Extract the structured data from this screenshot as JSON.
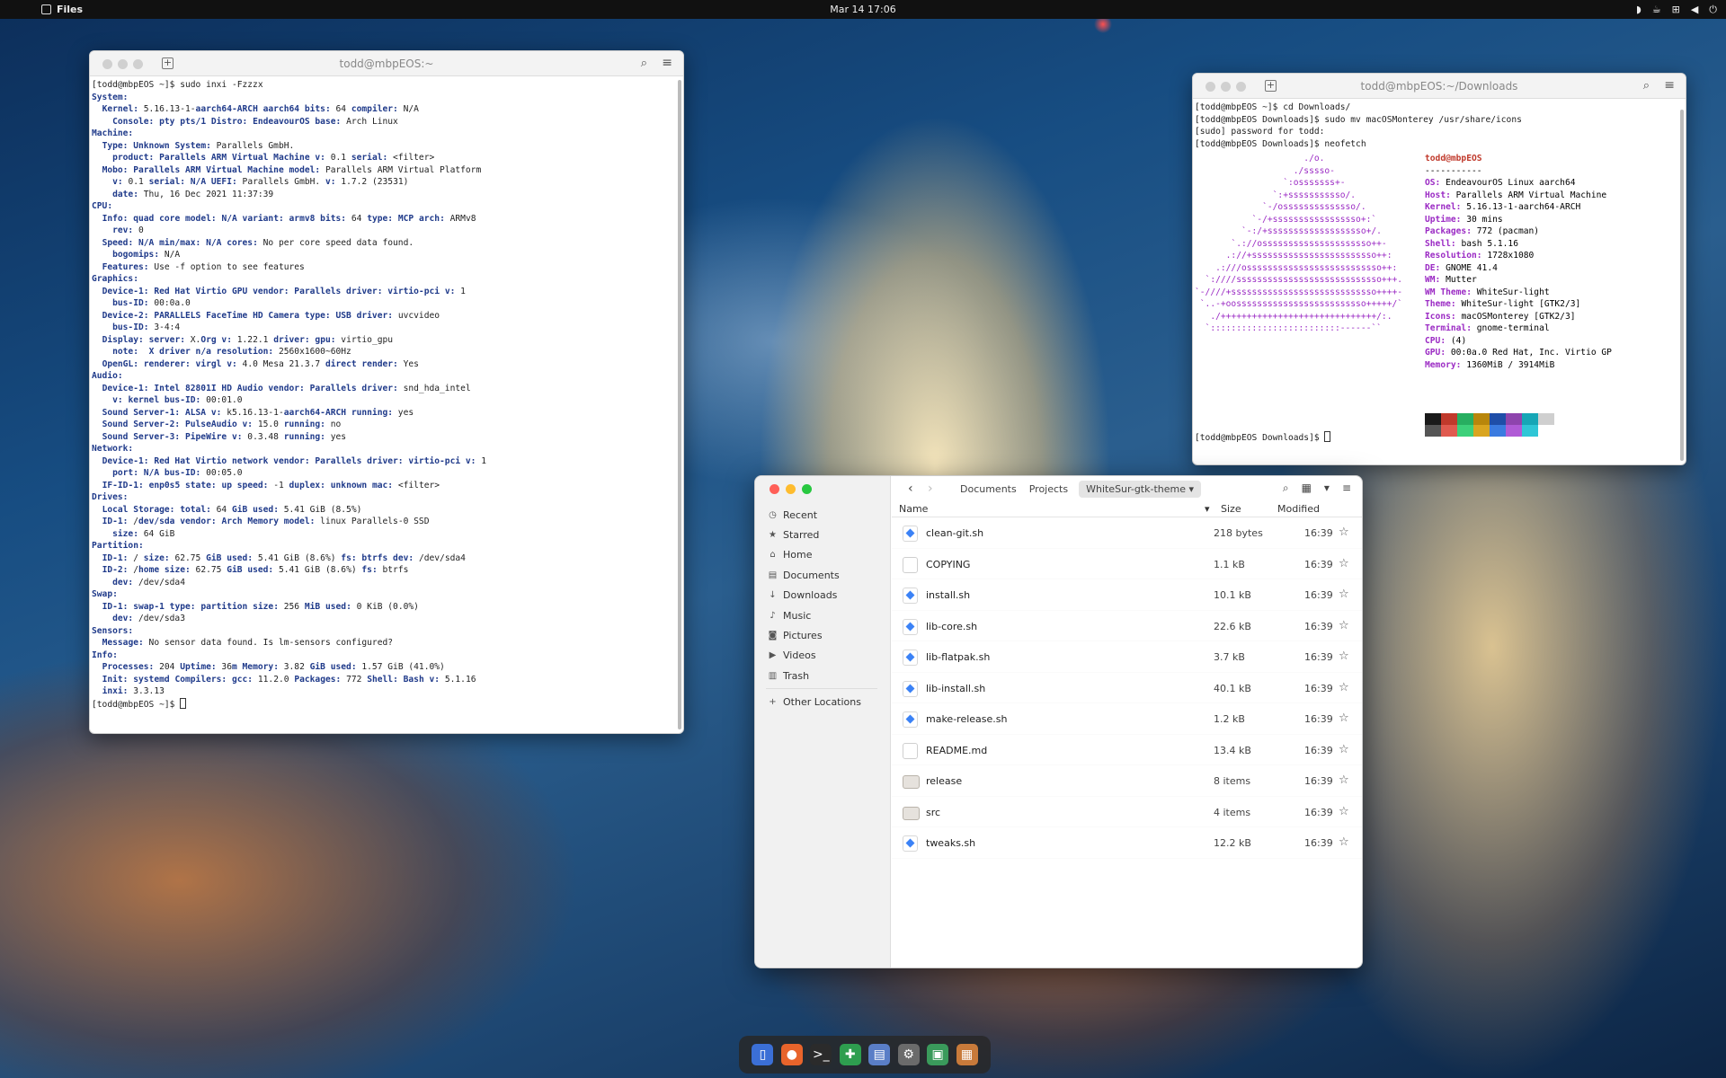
{
  "topbar": {
    "app_name": "Files",
    "clock": "Mar 14  17:06"
  },
  "terminal_left": {
    "title": "todd@mbpEOS:~",
    "lines": [
      "[todd@mbpEOS ~]$ sudo inxi -Fzzzx",
      "System:",
      "  Kernel: 5.16.13-1-aarch64-ARCH aarch64 bits: 64 compiler: N/A",
      "    Console: pty pts/1 Distro: EndeavourOS base: Arch Linux",
      "Machine:",
      "  Type: Unknown System: Parallels GmbH.",
      "    product: Parallels ARM Virtual Machine v: 0.1 serial: <filter>",
      "  Mobo: Parallels ARM Virtual Machine model: Parallels ARM Virtual Platform",
      "    v: 0.1 serial: N/A UEFI: Parallels GmbH. v: 1.7.2 (23531)",
      "    date: Thu, 16 Dec 2021 11:37:39",
      "CPU:",
      "  Info: quad core model: N/A variant: armv8 bits: 64 type: MCP arch: ARMv8",
      "    rev: 0",
      "  Speed: N/A min/max: N/A cores: No per core speed data found.",
      "    bogomips: N/A",
      "  Features: Use -f option to see features",
      "Graphics:",
      "  Device-1: Red Hat Virtio GPU vendor: Parallels driver: virtio-pci v: 1",
      "    bus-ID: 00:0a.0",
      "  Device-2: PARALLELS FaceTime HD Camera type: USB driver: uvcvideo",
      "    bus-ID: 3-4:4",
      "  Display: server: X.Org v: 1.22.1 driver: gpu: virtio_gpu",
      "    note:  X driver n/a resolution: 2560x1600~60Hz",
      "  OpenGL: renderer: virgl v: 4.0 Mesa 21.3.7 direct render: Yes",
      "Audio:",
      "  Device-1: Intel 82801I HD Audio vendor: Parallels driver: snd_hda_intel",
      "    v: kernel bus-ID: 00:01.0",
      "  Sound Server-1: ALSA v: k5.16.13-1-aarch64-ARCH running: yes",
      "  Sound Server-2: PulseAudio v: 15.0 running: no",
      "  Sound Server-3: PipeWire v: 0.3.48 running: yes",
      "Network:",
      "  Device-1: Red Hat Virtio network vendor: Parallels driver: virtio-pci v: 1",
      "    port: N/A bus-ID: 00:05.0",
      "  IF-ID-1: enp0s5 state: up speed: -1 duplex: unknown mac: <filter>",
      "Drives:",
      "  Local Storage: total: 64 GiB used: 5.41 GiB (8.5%)",
      "  ID-1: /dev/sda vendor: Arch Memory model: linux Parallels-0 SSD",
      "    size: 64 GiB",
      "Partition:",
      "  ID-1: / size: 62.75 GiB used: 5.41 GiB (8.6%) fs: btrfs dev: /dev/sda4",
      "  ID-2: /home size: 62.75 GiB used: 5.41 GiB (8.6%) fs: btrfs",
      "    dev: /dev/sda4",
      "Swap:",
      "  ID-1: swap-1 type: partition size: 256 MiB used: 0 KiB (0.0%)",
      "    dev: /dev/sda3",
      "Sensors:",
      "  Message: No sensor data found. Is lm-sensors configured?",
      "Info:",
      "  Processes: 204 Uptime: 36m Memory: 3.82 GiB used: 1.57 GiB (41.0%)",
      "  Init: systemd Compilers: gcc: 11.2.0 Packages: 772 Shell: Bash v: 5.1.16",
      "  inxi: 3.3.13"
    ],
    "prompt": "[todd@mbpEOS ~]$ "
  },
  "terminal_right": {
    "title": "todd@mbpEOS:~/Downloads",
    "lines": [
      "[todd@mbpEOS ~]$ cd Downloads/",
      "[todd@mbpEOS Downloads]$ sudo mv macOSMonterey /usr/share/icons",
      "[sudo] password for todd:",
      "[todd@mbpEOS Downloads]$ neofetch"
    ],
    "logo": [
      "                     ./o.",
      "                   ./sssso-",
      "                 `:osssssss+-",
      "               `:+sssssssssso/.",
      "             `-/ossssssssssssso/.",
      "           `-/+sssssssssssssssso+:`",
      "         `-:/+sssssssssssssssssso+/.",
      "       `.://osssssssssssssssssssso++-",
      "      .://+ssssssssssssssssssssssso++:",
      "    .:///ossssssssssssssssssssssssso++:",
      "  `:////ssssssssssssssssssssssssssso+++.",
      "`-////+ssssssssssssssssssssssssssso++++-",
      " `..-+oosssssssssssssssssssssssso+++++/`",
      "   ./++++++++++++++++++++++++++++++/:.",
      "  `:::::::::::::::::::::::::------``"
    ],
    "user_host": "todd@mbpEOS",
    "underline": "-----------",
    "info": [
      {
        "label": "OS",
        "value": "EndeavourOS Linux aarch64"
      },
      {
        "label": "Host",
        "value": "Parallels ARM Virtual Machine"
      },
      {
        "label": "Kernel",
        "value": "5.16.13-1-aarch64-ARCH"
      },
      {
        "label": "Uptime",
        "value": "30 mins"
      },
      {
        "label": "Packages",
        "value": "772 (pacman)"
      },
      {
        "label": "Shell",
        "value": "bash 5.1.16"
      },
      {
        "label": "Resolution",
        "value": "1728x1080"
      },
      {
        "label": "DE",
        "value": "GNOME 41.4"
      },
      {
        "label": "WM",
        "value": "Mutter"
      },
      {
        "label": "WM Theme",
        "value": "WhiteSur-light"
      },
      {
        "label": "Theme",
        "value": "WhiteSur-light [GTK2/3]"
      },
      {
        "label": "Icons",
        "value": "macOSMonterey [GTK2/3]"
      },
      {
        "label": "Terminal",
        "value": "gnome-terminal"
      },
      {
        "label": "CPU",
        "value": "(4)"
      },
      {
        "label": "GPU",
        "value": "00:0a.0 Red Hat, Inc. Virtio GP"
      },
      {
        "label": "Memory",
        "value": "1360MiB / 3914MiB"
      }
    ],
    "swatch_colors": {
      "top": [
        "#1a1a1a",
        "#c0392b",
        "#27ae60",
        "#b8860b",
        "#1f4ea8",
        "#8e44ad",
        "#16a6b6",
        "#cfcfcf"
      ],
      "bottom": [
        "#555555",
        "#e05a4f",
        "#3dd07a",
        "#d9a520",
        "#3b7be0",
        "#b05bd6",
        "#2fc6d6",
        "#ffffff"
      ]
    },
    "prompt": "[todd@mbpEOS Downloads]$ "
  },
  "files": {
    "traffic_colors": [
      "#ff5f57",
      "#febc2e",
      "#28c840"
    ],
    "sidebar": [
      {
        "icon": "clock-icon",
        "glyph": "◷",
        "label": "Recent"
      },
      {
        "icon": "star-icon",
        "glyph": "★",
        "label": "Starred"
      },
      {
        "icon": "home-icon",
        "glyph": "⌂",
        "label": "Home"
      },
      {
        "icon": "document-icon",
        "glyph": "▤",
        "label": "Documents"
      },
      {
        "icon": "download-icon",
        "glyph": "↓",
        "label": "Downloads"
      },
      {
        "icon": "music-icon",
        "glyph": "♪",
        "label": "Music"
      },
      {
        "icon": "camera-icon",
        "glyph": "◙",
        "label": "Pictures"
      },
      {
        "icon": "video-icon",
        "glyph": "▶",
        "label": "Videos"
      },
      {
        "icon": "trash-icon",
        "glyph": "▥",
        "label": "Trash"
      }
    ],
    "other_locations": "Other Locations",
    "breadcrumbs": [
      "Documents",
      "Projects",
      "WhiteSur-gtk-theme"
    ],
    "columns": {
      "name": "Name",
      "size": "Size",
      "modified": "Modified"
    },
    "rows": [
      {
        "name": "clean-git.sh",
        "size": "218 bytes",
        "modified": "16:39",
        "type": "sh"
      },
      {
        "name": "COPYING",
        "size": "1.1 kB",
        "modified": "16:39",
        "type": "txt"
      },
      {
        "name": "install.sh",
        "size": "10.1 kB",
        "modified": "16:39",
        "type": "sh"
      },
      {
        "name": "lib-core.sh",
        "size": "22.6 kB",
        "modified": "16:39",
        "type": "sh"
      },
      {
        "name": "lib-flatpak.sh",
        "size": "3.7 kB",
        "modified": "16:39",
        "type": "sh"
      },
      {
        "name": "lib-install.sh",
        "size": "40.1 kB",
        "modified": "16:39",
        "type": "sh"
      },
      {
        "name": "make-release.sh",
        "size": "1.2 kB",
        "modified": "16:39",
        "type": "sh"
      },
      {
        "name": "README.md",
        "size": "13.4 kB",
        "modified": "16:39",
        "type": "txt"
      },
      {
        "name": "release",
        "size": "8 items",
        "modified": "16:39",
        "type": "dir"
      },
      {
        "name": "src",
        "size": "4 items",
        "modified": "16:39",
        "type": "dir"
      },
      {
        "name": "tweaks.sh",
        "size": "12.2 kB",
        "modified": "16:39",
        "type": "sh"
      }
    ]
  },
  "dock": [
    {
      "name": "files-dock-icon",
      "color": "#3b6fd6",
      "glyph": "▯"
    },
    {
      "name": "firefox-dock-icon",
      "color": "#e8642b",
      "glyph": "●"
    },
    {
      "name": "terminal-dock-icon",
      "color": "#2b2b2b",
      "glyph": ">_"
    },
    {
      "name": "extensions-dock-icon",
      "color": "#2e9e4f",
      "glyph": "✚"
    },
    {
      "name": "text-editor-dock-icon",
      "color": "#5a7ec7",
      "glyph": "▤"
    },
    {
      "name": "settings-dock-icon",
      "color": "#6b6b6b",
      "glyph": "⚙"
    },
    {
      "name": "software-dock-icon",
      "color": "#3a9a5b",
      "glyph": "▣"
    },
    {
      "name": "app-grid-dock-icon",
      "color": "#c87a3a",
      "glyph": "▦"
    }
  ]
}
